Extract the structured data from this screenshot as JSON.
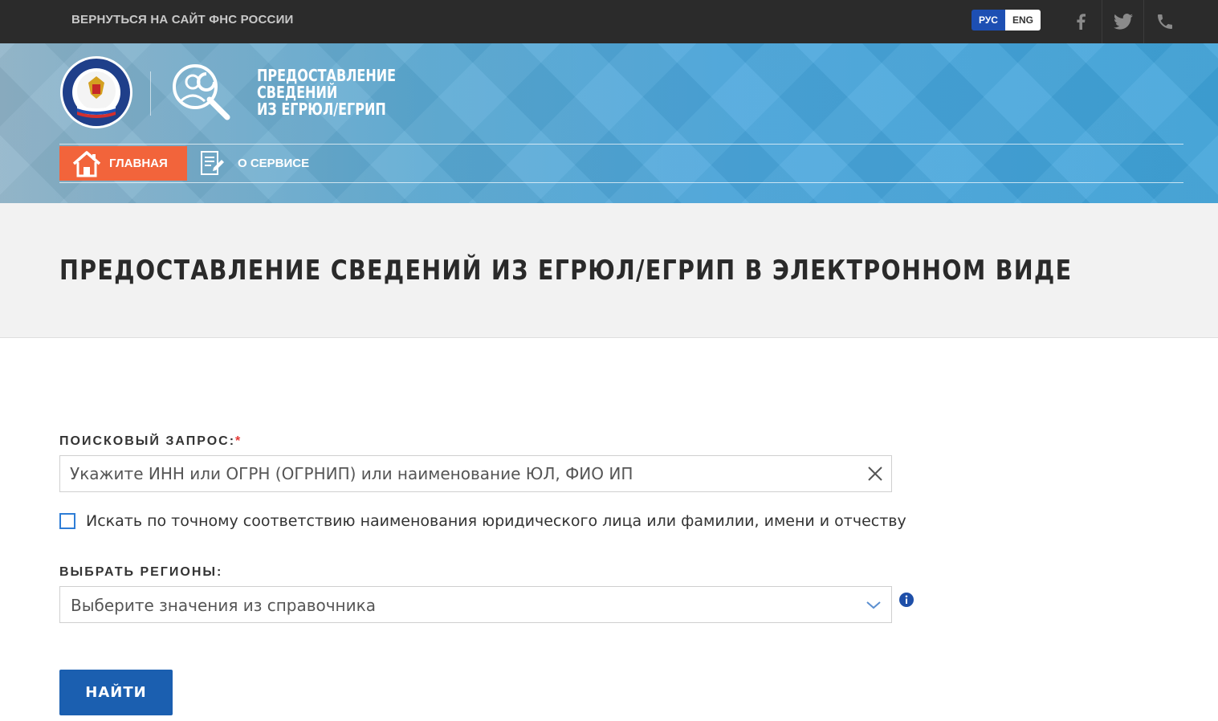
{
  "topbar": {
    "back_link": "ВЕРНУТЬСЯ НА САЙТ ФНС РОССИИ",
    "lang_ru": "РУС",
    "lang_en": "ENG",
    "icons": [
      "facebook-icon",
      "twitter-icon",
      "phone-icon"
    ]
  },
  "header": {
    "emblem_text": "ФЕДЕРАЛЬНАЯ НАЛОГОВАЯ СЛУЖБА",
    "service_title_line1": "ПРЕДОСТАВЛЕНИЕ",
    "service_title_line2": "СВЕДЕНИЙ",
    "service_title_line3": "ИЗ ЕГРЮЛ/ЕГРИП",
    "nav": {
      "home": "ГЛАВНАЯ",
      "about": "О СЕРВИСЕ"
    },
    "colors": {
      "home_active": "#f2643b",
      "banner": "#4aa6dc"
    }
  },
  "page": {
    "title": "ПРЕДОСТАВЛЕНИЕ СВЕДЕНИЙ ИЗ ЕГРЮЛ/ЕГРИП В ЭЛЕКТРОННОМ ВИДЕ"
  },
  "form": {
    "search_label": "ПОИСКОВЫЙ ЗАПРОС:",
    "search_required_mark": "*",
    "search_value": "",
    "search_placeholder": "Укажите ИНН или ОГРН (ОГРНИП) или наименование ЮЛ, ФИО ИП",
    "exact_match_label": "Искать по точному соответствию наименования юридического лица или фамилии, имени и отчеству",
    "exact_match_checked": false,
    "regions_label": "ВЫБРАТЬ РЕГИОНЫ:",
    "regions_placeholder": "Выберите значения из справочника",
    "submit_label": "НАЙТИ",
    "button_color": "#1b5fb0"
  }
}
